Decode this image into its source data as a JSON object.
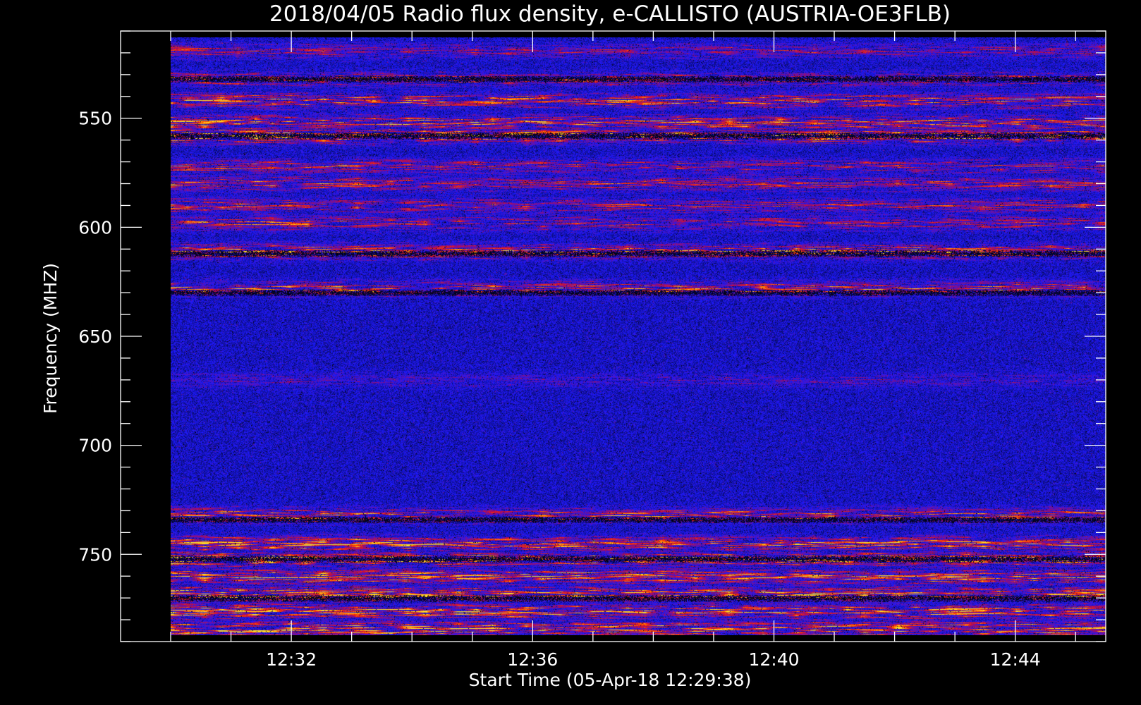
{
  "chart_data": {
    "type": "heatmap",
    "title": "2018/04/05  Radio flux density, e-CALLISTO (AUSTRIA-OE3FLB)",
    "xlabel": "Start Time (05-Apr-18 12:29:38)",
    "ylabel": "Frequency (MHZ)",
    "x_start": "12:29:38",
    "x_end": "12:45:00",
    "x_range_minutes": [
      -0.83,
      15.5
    ],
    "x_ticks": [
      {
        "label": "12:32",
        "minutes": 2
      },
      {
        "label": "12:36",
        "minutes": 6
      },
      {
        "label": "12:40",
        "minutes": 10
      },
      {
        "label": "12:44",
        "minutes": 14
      }
    ],
    "x_minor_step_minutes": 1,
    "y_range_mhz": [
      510,
      790
    ],
    "y_axis_inverted": true,
    "y_ticks": [
      550,
      600,
      650,
      700,
      750
    ],
    "y_minor_step_mhz": 10,
    "frequency_coverage_mhz": [
      513,
      787
    ],
    "colormap": [
      "#000000",
      "#1a1aff",
      "#b40a50",
      "#ff3200",
      "#ff8c00",
      "#ffdc28"
    ],
    "intensity_scale": "0 = background (blue), 1 = strongest (yellow)",
    "bands": [
      {
        "freq_mhz": 519,
        "intensity": 0.45
      },
      {
        "freq_mhz": 532,
        "intensity": 0.55
      },
      {
        "freq_mhz": 542,
        "intensity": 0.75
      },
      {
        "freq_mhz": 552,
        "intensity": 0.8
      },
      {
        "freq_mhz": 558,
        "intensity": 0.9
      },
      {
        "freq_mhz": 572,
        "intensity": 0.55
      },
      {
        "freq_mhz": 580,
        "intensity": 0.6
      },
      {
        "freq_mhz": 590,
        "intensity": 0.55
      },
      {
        "freq_mhz": 598,
        "intensity": 0.55
      },
      {
        "freq_mhz": 611,
        "intensity": 0.8
      },
      {
        "freq_mhz": 628,
        "intensity": 0.7
      },
      {
        "freq_mhz": 670,
        "intensity": 0.25
      },
      {
        "freq_mhz": 732,
        "intensity": 0.7
      },
      {
        "freq_mhz": 745,
        "intensity": 0.85
      },
      {
        "freq_mhz": 752,
        "intensity": 0.9
      },
      {
        "freq_mhz": 760,
        "intensity": 0.9
      },
      {
        "freq_mhz": 768,
        "intensity": 0.9
      },
      {
        "freq_mhz": 776,
        "intensity": 0.9
      },
      {
        "freq_mhz": 784,
        "intensity": 0.95
      }
    ],
    "dark_lines_mhz": [
      532,
      558,
      612,
      630,
      734,
      752,
      770
    ],
    "grid": false,
    "legend": "none"
  }
}
